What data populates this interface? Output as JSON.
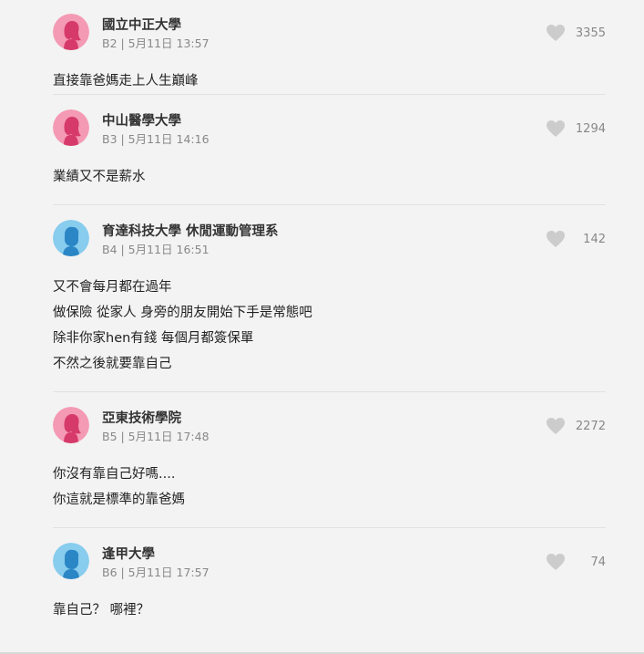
{
  "comments": [
    {
      "author": "國立中正大學",
      "meta": "B2 | 5月11日 13:57",
      "likes": "3355",
      "avatar": "female-avatar-icon",
      "lines": [
        "直接靠爸媽走上人生巔峰"
      ]
    },
    {
      "author": "中山醫學大學",
      "meta": "B3 | 5月11日 14:16",
      "likes": "1294",
      "avatar": "female-avatar-icon",
      "lines": [
        "業績又不是薪水"
      ]
    },
    {
      "author": "育達科技大學 休閒運動管理系",
      "meta": "B4 | 5月11日 16:51",
      "likes": "142",
      "avatar": "male-avatar-icon",
      "lines": [
        "又不會每月都在過年",
        "做保險 從家人 身旁的朋友開始下手是常態吧",
        "除非你家hen有錢 每個月都簽保單",
        "不然之後就要靠自己"
      ]
    },
    {
      "author": "亞東技術學院",
      "meta": "B5 | 5月11日 17:48",
      "likes": "2272",
      "avatar": "female-avatar-icon",
      "lines": [
        "你沒有靠自己好嗎....",
        "你這就是標準的靠爸媽"
      ]
    },
    {
      "author": "逢甲大學",
      "meta": "B6 | 5月11日 17:57",
      "likes": "74",
      "avatar": "male-avatar-icon",
      "lines": [
        "靠自己？ 哪裡？"
      ]
    }
  ],
  "colors": {
    "background": "#f3f3f3",
    "female_avatar_bg": "#f49ab4",
    "female_avatar_fg": "#d63a6a",
    "male_avatar_bg": "#88ccee",
    "male_avatar_fg": "#2b86c5",
    "heart": "#cccccc",
    "meta_text": "#888888"
  }
}
